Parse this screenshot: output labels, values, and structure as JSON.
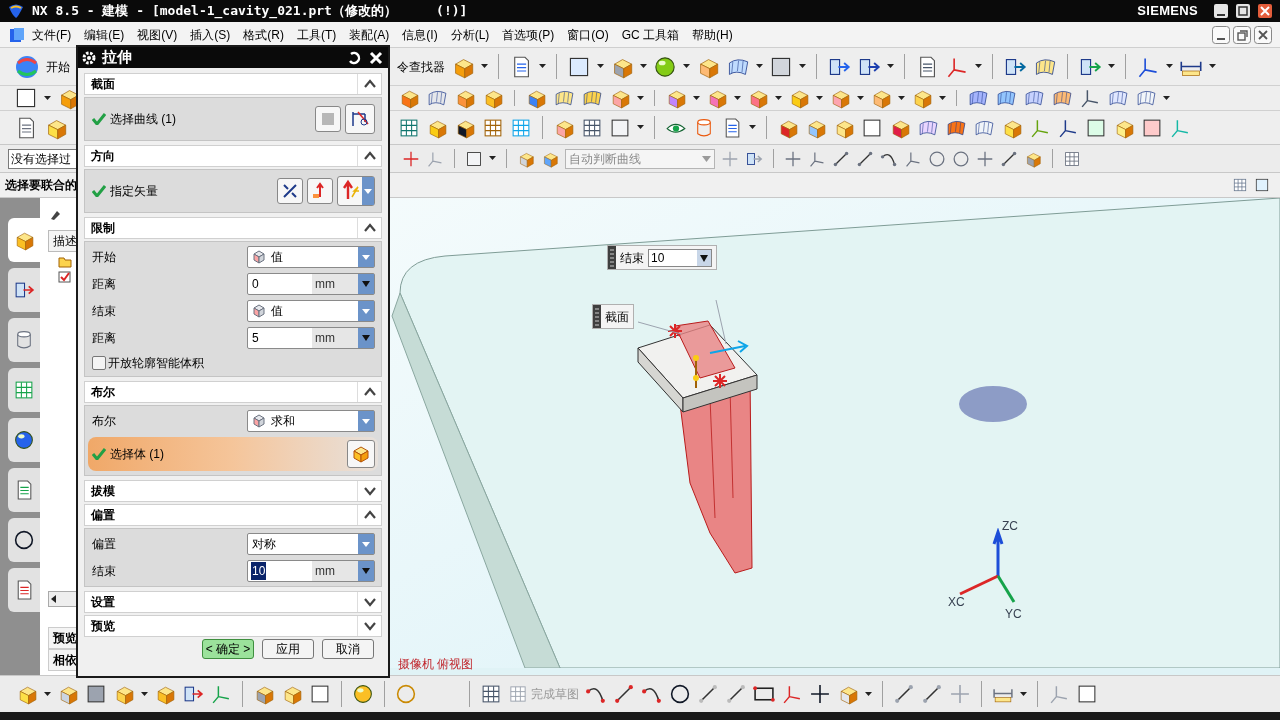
{
  "window": {
    "title": "NX 8.5 - 建模 - [model-1_cavity_021.prt（修改的）     (!)]",
    "brand": "SIEMENS"
  },
  "menu": [
    "文件(F)",
    "编辑(E)",
    "视图(V)",
    "插入(S)",
    "格式(R)",
    "工具(T)",
    "装配(A)",
    "信息(I)",
    "分析(L)",
    "首选项(P)",
    "窗口(O)",
    "GC 工具箱",
    "帮助(H)"
  ],
  "toolbar": {
    "start_label": "开始",
    "finder_label": "令查找器"
  },
  "selection_bar": {
    "filter": "没有选择过",
    "curve_rule": "自动判断曲线"
  },
  "prompt": "选择要联合的",
  "resource_tabs": [
    {
      "selected": true
    },
    {
      "selected": false
    },
    {
      "selected": false
    },
    {
      "selected": false
    },
    {
      "selected": false
    },
    {
      "selected": false
    },
    {
      "selected": false
    },
    {
      "selected": false
    }
  ],
  "navigator": {
    "column": "描述",
    "panels": [
      "预览",
      "相依"
    ]
  },
  "dialog": {
    "title": "拉伸",
    "sections": [
      {
        "title": "截面",
        "expanded": true,
        "rows": [
          {
            "kind": "select",
            "label": "选择曲线 (1)",
            "checked": true,
            "active": false
          }
        ]
      },
      {
        "title": "方向",
        "expanded": true,
        "rows": [
          {
            "kind": "vector",
            "label": "指定矢量",
            "checked": true
          }
        ]
      },
      {
        "title": "限制",
        "expanded": true,
        "rows": [
          {
            "kind": "icon_dropdown",
            "label": "开始",
            "value": "值"
          },
          {
            "kind": "number",
            "label": "距离",
            "value": "0",
            "unit": "mm",
            "selected": false
          },
          {
            "kind": "icon_dropdown",
            "label": "结束",
            "value": "值"
          },
          {
            "kind": "number",
            "label": "距离",
            "value": "5",
            "unit": "mm",
            "selected": false
          },
          {
            "kind": "checkbox",
            "label": "开放轮廓智能体积",
            "checked": false
          }
        ]
      },
      {
        "title": "布尔",
        "expanded": true,
        "rows": [
          {
            "kind": "icon_dropdown",
            "label": "布尔",
            "value": "求和"
          },
          {
            "kind": "select",
            "label": "选择体 (1)",
            "checked": true,
            "active": true
          }
        ]
      },
      {
        "title": "拔模",
        "expanded": false
      },
      {
        "title": "偏置",
        "expanded": true,
        "rows": [
          {
            "kind": "dropdown",
            "label": "偏置",
            "value": "对称"
          },
          {
            "kind": "number",
            "label": "结束",
            "value": "10",
            "unit": "mm",
            "selected": true
          }
        ]
      },
      {
        "title": "设置",
        "expanded": false
      },
      {
        "title": "预览",
        "expanded": false
      }
    ],
    "buttons": [
      {
        "label": "< 确定 >",
        "default": true
      },
      {
        "label": "应用",
        "default": false
      },
      {
        "label": "取消",
        "default": false
      }
    ]
  },
  "viewport": {
    "callouts": [
      {
        "label": "结束",
        "value": "10"
      },
      {
        "label": "截面"
      }
    ],
    "axes": [
      "ZC",
      "XC",
      "YC"
    ],
    "status": "摄像机 俯视图"
  },
  "sketch_toolbar": {
    "finish_label": "完成草图"
  }
}
